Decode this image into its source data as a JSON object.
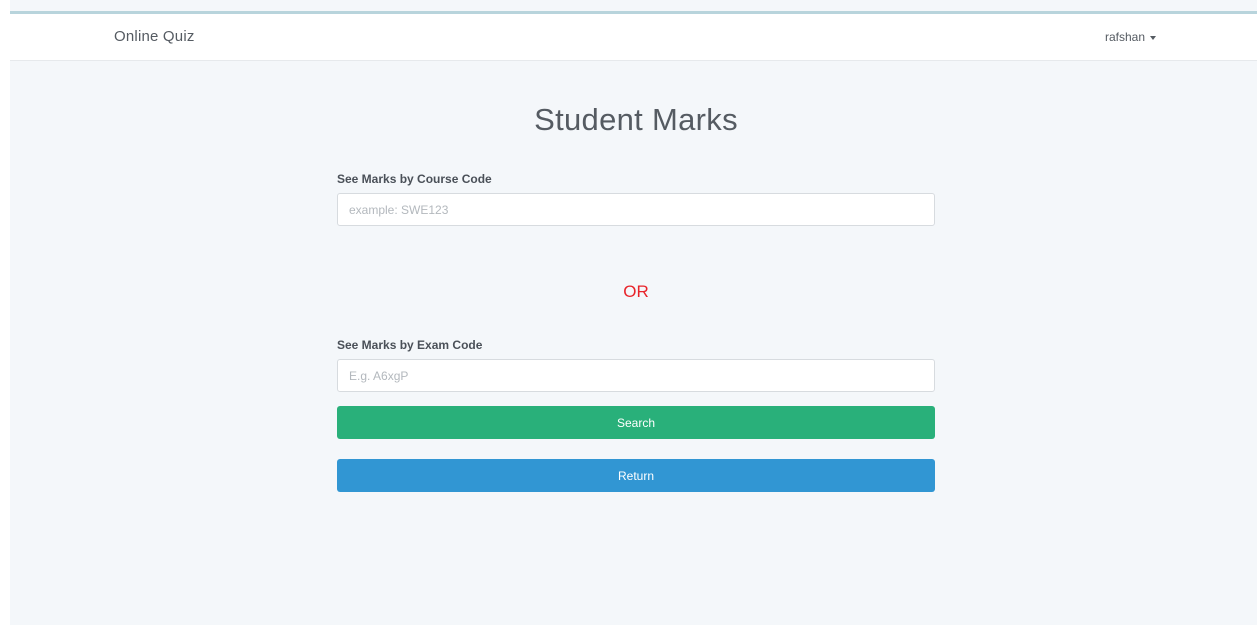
{
  "navbar": {
    "brand": "Online Quiz",
    "user": "rafshan"
  },
  "page": {
    "title": "Student Marks"
  },
  "form": {
    "course_code": {
      "label": "See Marks by Course Code",
      "placeholder": "example: SWE123",
      "value": ""
    },
    "divider": "OR",
    "exam_code": {
      "label": "See Marks by Exam Code",
      "placeholder": "E.g. A6xgP",
      "value": ""
    },
    "search_label": "Search",
    "return_label": "Return"
  },
  "colors": {
    "accent_bar": "#b8d4dc",
    "background": "#f4f7fa",
    "or_text": "#e8242a",
    "search_button": "#29b07a",
    "return_button": "#3196d3"
  },
  "icons": {
    "user_menu_caret": "caret-down-icon"
  }
}
